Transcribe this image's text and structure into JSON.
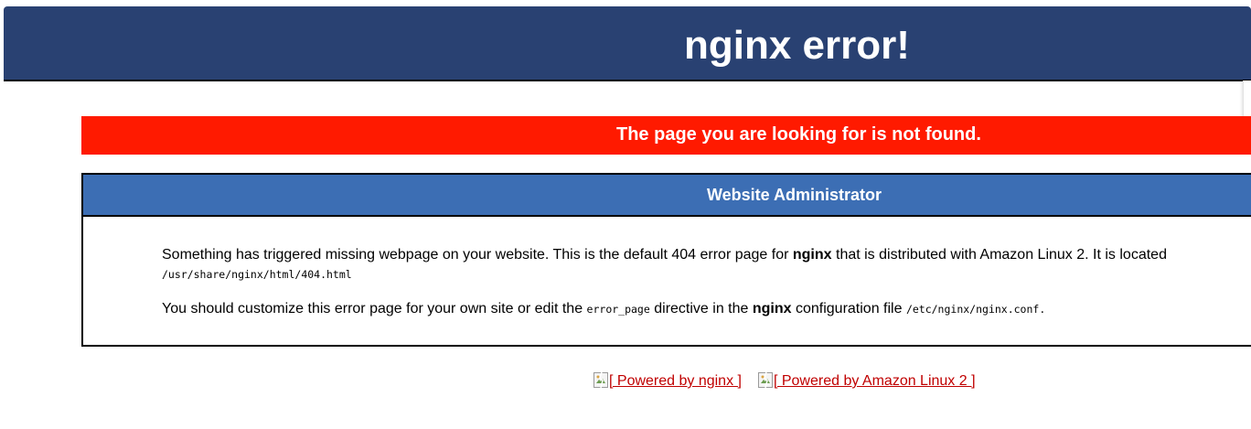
{
  "header": {
    "title": "nginx error!"
  },
  "alert": {
    "message": "The page you are looking for is not found."
  },
  "admin_box": {
    "heading": "Website Administrator",
    "paragraph1": {
      "text_a": "Something has triggered missing webpage on your website. This is the default 404 error page for ",
      "bold": "nginx",
      "text_b": " that is distributed with Amazon Linux 2. It is located",
      "path": "/usr/share/nginx/html/404.html"
    },
    "paragraph2": {
      "text_a": "You should customize this error page for your own site or edit the ",
      "code": "error_page",
      "text_b": " directive in the ",
      "bold": "nginx",
      "text_c": " configuration file ",
      "path": "/etc/nginx/nginx.conf",
      "text_d": "."
    }
  },
  "footer_links": [
    {
      "label": "[ Powered by nginx ]",
      "icon": "broken-image-icon"
    },
    {
      "label": "[ Powered by Amazon Linux 2 ]",
      "icon": "broken-image-icon"
    }
  ],
  "colors": {
    "header_bg": "#294172",
    "alert_bg": "#ff1a00",
    "box_head_bg": "#3c6eb4",
    "link": "#c00000"
  }
}
